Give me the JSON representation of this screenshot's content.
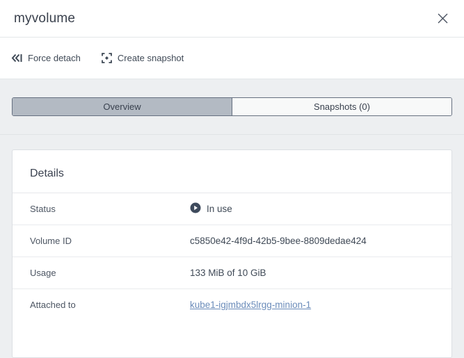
{
  "panel": {
    "title": "myvolume"
  },
  "toolbar": {
    "buttons": [
      {
        "icon": "force-detach-icon",
        "label": "Force detach"
      },
      {
        "icon": "create-snapshot-icon",
        "label": "Create snapshot"
      }
    ]
  },
  "tabs": [
    {
      "label": "Overview",
      "selected": true
    },
    {
      "label": "Snapshots (0)",
      "selected": false
    }
  ],
  "details": {
    "heading": "Details",
    "rows": [
      {
        "label": "Status",
        "value": "In use",
        "icon": "status-in-use-play-icon"
      },
      {
        "label": "Volume ID",
        "value": "c5850e42-4f9d-42b5-9bee-8809dedae424"
      },
      {
        "label": "Usage",
        "value": "133 MiB of 10 GiB"
      },
      {
        "label": "Attached to",
        "value": "kube1-igjmbdx5lrgg-minion-1",
        "link": true
      }
    ]
  },
  "colors": {
    "background": "#edeff1",
    "surface": "#ffffff",
    "text_primary": "#3f4956",
    "text_label": "#4d5663",
    "tab_selected_fill": "#b3bac3",
    "tab_border": "#667080",
    "link_blue": "#6b8cba",
    "status_icon_fill": "#3e4a5c",
    "divider": "#e4e7e9"
  }
}
